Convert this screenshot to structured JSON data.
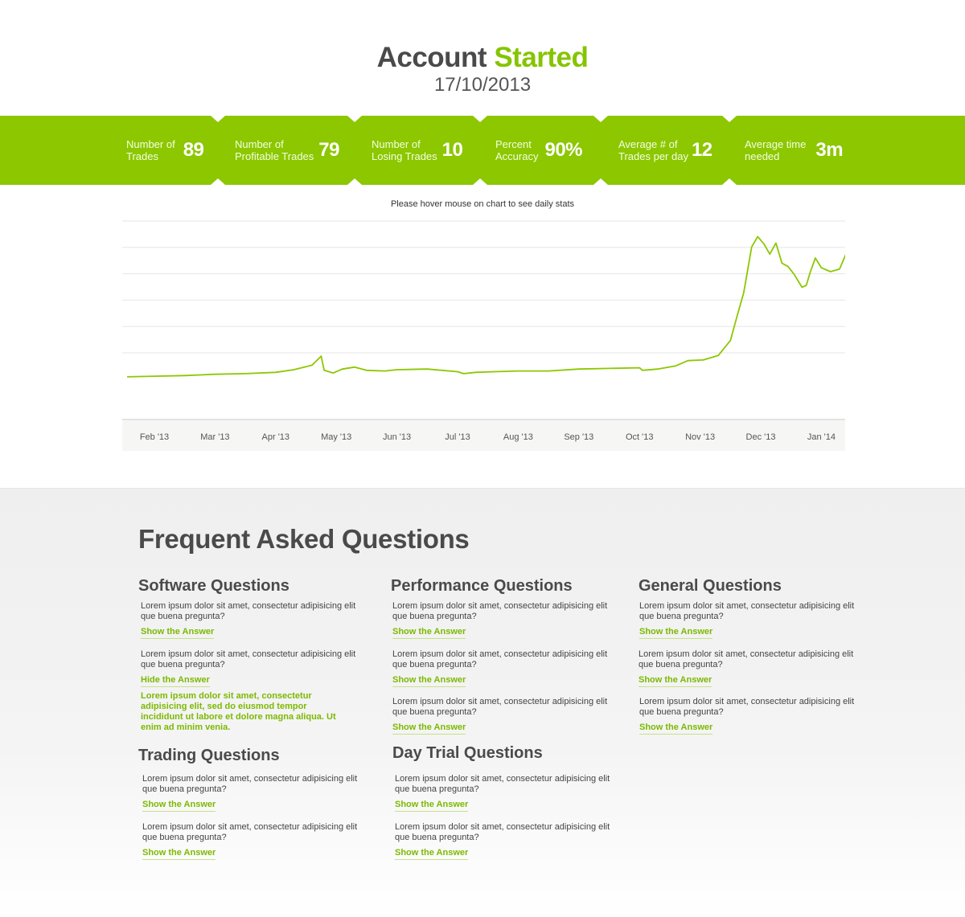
{
  "header": {
    "title_main": "Account",
    "title_accent": "Started",
    "date": "17/10/2013"
  },
  "colors": {
    "accent": "#8cc700",
    "text_dark": "#4a4a4a",
    "link": "#7cb900"
  },
  "stats": [
    {
      "label_1": "Number of",
      "label_2": "Trades",
      "value": "89"
    },
    {
      "label_1": "Number of",
      "label_2": "Profitable Trades",
      "value": "79"
    },
    {
      "label_1": "Number of",
      "label_2": "Losing Trades",
      "value": "10"
    },
    {
      "label_1": "Percent",
      "label_2": "Accuracy",
      "value": "90%"
    },
    {
      "label_1": "Average # of",
      "label_2": "Trades per day",
      "value": "12"
    },
    {
      "label_1": "Average time",
      "label_2": "needed",
      "value": "3m"
    }
  ],
  "chart_hint": "Please hover mouse on chart to see daily stats",
  "chart_data": {
    "type": "line",
    "title": "",
    "xlabel": "",
    "ylabel": "",
    "x_ticks": [
      "Feb '13",
      "Mar '13",
      "Apr '13",
      "May '13",
      "Jun '13",
      "Jul '13",
      "Aug '13",
      "Sep '13",
      "Oct '13",
      "Nov '13",
      "Dec '13",
      "Jan '14"
    ],
    "y_gridlines": 6,
    "x_range": [
      0,
      11.8
    ],
    "ylim": [
      0,
      250
    ],
    "grid": true,
    "series": [
      {
        "color": "#8cc700",
        "points": [
          [
            -0.45,
            10
          ],
          [
            0,
            11
          ],
          [
            0.5,
            12
          ],
          [
            1,
            14
          ],
          [
            1.5,
            15
          ],
          [
            2,
            17
          ],
          [
            2.3,
            21
          ],
          [
            2.6,
            28
          ],
          [
            2.75,
            42
          ],
          [
            2.8,
            20
          ],
          [
            2.95,
            16
          ],
          [
            3.1,
            22
          ],
          [
            3.3,
            25
          ],
          [
            3.5,
            20
          ],
          [
            3.8,
            19
          ],
          [
            4,
            21
          ],
          [
            4.5,
            22
          ],
          [
            5,
            18
          ],
          [
            5.1,
            15
          ],
          [
            5.3,
            17
          ],
          [
            5.6,
            18
          ],
          [
            6,
            19
          ],
          [
            6.5,
            19
          ],
          [
            7,
            22
          ],
          [
            7.5,
            23
          ],
          [
            8,
            24
          ],
          [
            8.05,
            20
          ],
          [
            8.3,
            22
          ],
          [
            8.6,
            27
          ],
          [
            8.8,
            35
          ],
          [
            9.05,
            36
          ],
          [
            9.3,
            43
          ],
          [
            9.5,
            66
          ],
          [
            9.6,
            100
          ],
          [
            9.72,
            140
          ],
          [
            9.85,
            210
          ],
          [
            9.95,
            226
          ],
          [
            10.05,
            215
          ],
          [
            10.15,
            199
          ],
          [
            10.25,
            216
          ],
          [
            10.35,
            185
          ],
          [
            10.45,
            180
          ],
          [
            10.55,
            168
          ],
          [
            10.68,
            148
          ],
          [
            10.75,
            151
          ],
          [
            10.82,
            172
          ],
          [
            10.9,
            193
          ],
          [
            11,
            178
          ],
          [
            11.15,
            172
          ],
          [
            11.3,
            176
          ],
          [
            11.4,
            198
          ],
          [
            11.55,
            210
          ],
          [
            11.62,
            192
          ],
          [
            11.72,
            186
          ],
          [
            11.8,
            172
          ]
        ]
      }
    ]
  },
  "faq": {
    "title": "Frequent Asked Questions",
    "question_text": "Lorem ipsum dolor sit amet, consectetur adipisicing elit que buena pregunta?",
    "show_label": "Show the Answer",
    "hide_label": "Hide the Answer",
    "answer_text": "Lorem ipsum dolor sit amet, consectetur adipisicing elit, sed do eiusmod tempor incididunt ut labore et dolore magna aliqua. Ut enim ad minim venia.",
    "groups": {
      "software": "Software Questions",
      "performance": "Performance Questions",
      "general": "General Questions",
      "trading": "Trading Questions",
      "daytrial": "Day Trial Questions"
    }
  }
}
